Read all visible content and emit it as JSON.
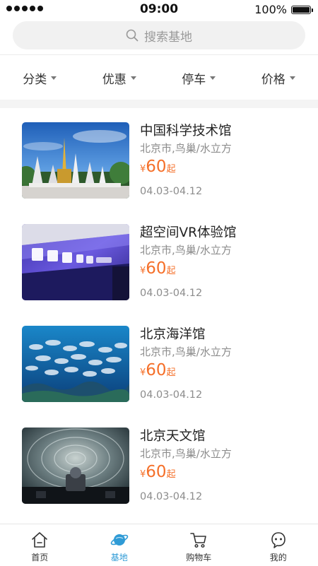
{
  "status_bar": {
    "time": "09:00",
    "battery": "100%"
  },
  "search": {
    "placeholder": "搜索基地"
  },
  "filters": [
    {
      "label": "分类"
    },
    {
      "label": "优惠"
    },
    {
      "label": "停车"
    },
    {
      "label": "价格"
    }
  ],
  "venues": [
    {
      "title": "中国科学技术馆",
      "location": "北京市,鸟巢/水立方",
      "currency": "¥",
      "price": "60",
      "price_suffix": "起",
      "dates": "04.03-04.12",
      "image": "temple-photo"
    },
    {
      "title": "超空间VR体验馆",
      "location": "北京市,鸟巢/水立方",
      "currency": "¥",
      "price": "60",
      "price_suffix": "起",
      "dates": "04.03-04.12",
      "image": "vr-sign-photo"
    },
    {
      "title": "北京海洋馆",
      "location": "北京市,鸟巢/水立方",
      "currency": "¥",
      "price": "60",
      "price_suffix": "起",
      "dates": "04.03-04.12",
      "image": "fish-school-photo"
    },
    {
      "title": "北京天文馆",
      "location": "北京市,鸟巢/水立方",
      "currency": "¥",
      "price": "60",
      "price_suffix": "起",
      "dates": "04.03-04.12",
      "image": "planetarium-dome-photo"
    }
  ],
  "tabs": [
    {
      "label": "首页",
      "icon": "home-icon",
      "active": false
    },
    {
      "label": "基地",
      "icon": "planet-icon",
      "active": true
    },
    {
      "label": "购物车",
      "icon": "cart-icon",
      "active": false
    },
    {
      "label": "我的",
      "icon": "profile-icon",
      "active": false
    }
  ],
  "colors": {
    "accent": "#2f9bd6",
    "price": "#f5702a"
  }
}
